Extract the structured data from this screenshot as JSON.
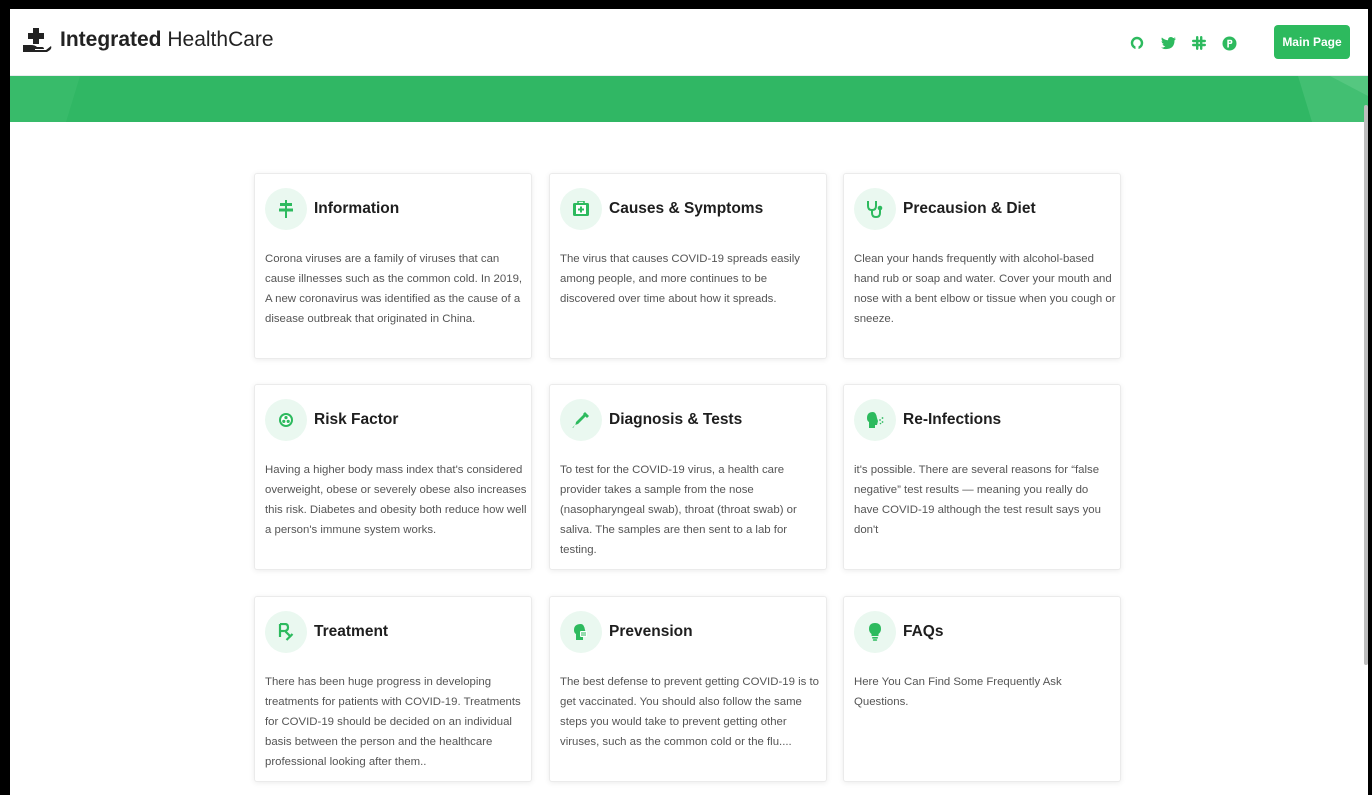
{
  "header": {
    "logo_bold": "Integrated",
    "logo_light": "HealthCare",
    "main_button": "Main Page",
    "social": [
      "github-icon",
      "twitter-icon",
      "slack-icon",
      "product-hunt-icon"
    ]
  },
  "colors": {
    "brand_green": "#2dba5e",
    "banner_green": "#30b764",
    "icon_bg": "#eaf8f0"
  },
  "cards": [
    {
      "title": "Information",
      "icon": "signpost-icon",
      "text": "Corona viruses are a family of viruses that can cause illnesses such as the common cold. In 2019, A new coronavirus was identified as the cause of a disease outbreak that originated in China."
    },
    {
      "title": "Causes & Symptoms",
      "icon": "first-aid-kit-icon",
      "text": "The virus that causes COVID-19 spreads easily among people, and more continues to be discovered over time about how it spreads."
    },
    {
      "title": "Precausion & Diet",
      "icon": "stethoscope-icon",
      "text": "Clean your hands frequently with alcohol-based hand rub or soap and water. Cover your mouth and nose with a bent elbow or tissue when you cough or sneeze."
    },
    {
      "title": "Risk Factor",
      "icon": "biohazard-icon",
      "text": "Having a higher body mass index that's considered overweight, obese or severely obese also increases this risk. Diabetes and obesity both reduce how well a person's immune system works."
    },
    {
      "title": "Diagnosis & Tests",
      "icon": "syringe-icon",
      "text": "To test for the COVID-19 virus, a health care provider takes a sample from the nose (nasopharyngeal swab), throat (throat swab) or saliva. The samples are then sent to a lab for testing."
    },
    {
      "title": "Re-Infections",
      "icon": "head-sneeze-icon",
      "text": "it's possible. There are several reasons for “false negative” test results — meaning you really do have COVID-19 although the test result says you don't"
    },
    {
      "title": "Treatment",
      "icon": "prescription-icon",
      "text": "There has been huge progress in developing treatments for patients with COVID-19. Treatments for COVID-19 should be decided on an individual basis between the person and the healthcare professional looking after them.."
    },
    {
      "title": "Prevension",
      "icon": "head-mask-icon",
      "text": "The best defense to prevent getting COVID-19 is to get vaccinated. You should also follow the same steps you would take to prevent getting other viruses, such as the common cold or the flu...."
    },
    {
      "title": "FAQs",
      "icon": "lightbulb-icon",
      "text": "Here You Can Find Some Frequently Ask Questions."
    }
  ]
}
